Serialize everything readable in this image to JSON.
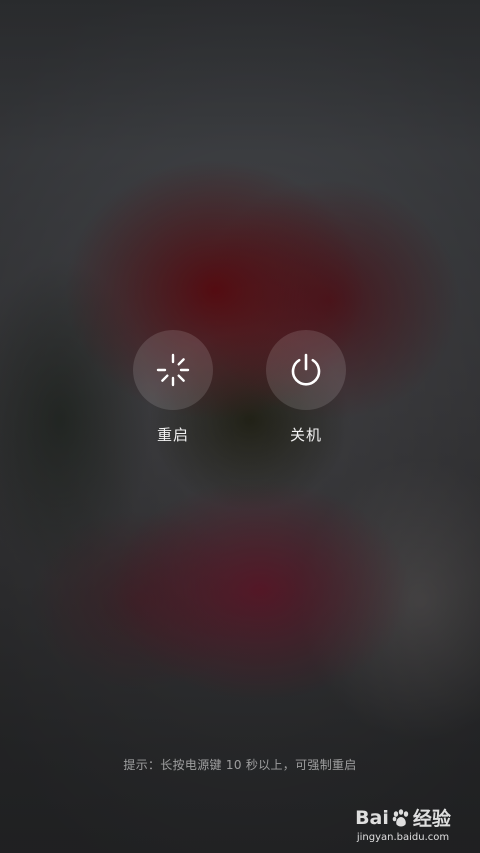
{
  "actions": {
    "restart": {
      "label": "重启",
      "icon": "restart-icon"
    },
    "shutdown": {
      "label": "关机",
      "icon": "power-icon"
    }
  },
  "hint": "提示：长按电源键 10 秒以上，可强制重启",
  "watermark": {
    "logo_left": "Bai",
    "logo_right": "经验",
    "url": "jingyan.baidu.com"
  },
  "colors": {
    "button_bg": "rgba(255,255,255,0.13)",
    "label_text": "#f2f2f2",
    "hint_text": "rgba(255,255,255,0.55)"
  }
}
